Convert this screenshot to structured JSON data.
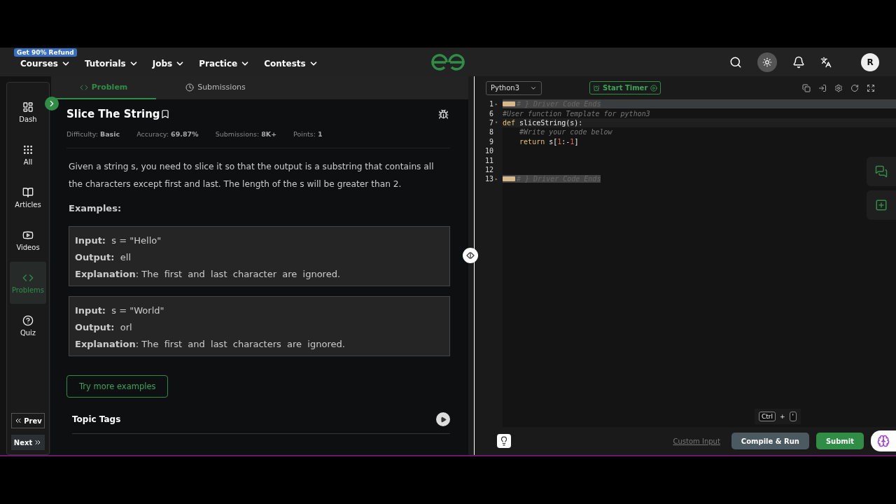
{
  "navbar": {
    "badge": "Get 90% Refund",
    "menus": [
      {
        "label": "Courses"
      },
      {
        "label": "Tutorials"
      },
      {
        "label": "Jobs"
      },
      {
        "label": "Practice"
      },
      {
        "label": "Contests"
      }
    ],
    "avatar": "R"
  },
  "sidebar": {
    "items": [
      {
        "label": "Dash",
        "selected": false
      },
      {
        "label": "All",
        "selected": false
      },
      {
        "label": "Articles",
        "selected": false
      },
      {
        "label": "Videos",
        "selected": false
      },
      {
        "label": "Problems",
        "selected": true
      },
      {
        "label": "Quiz",
        "selected": false
      }
    ],
    "prev": "Prev",
    "next": "Next"
  },
  "tabs": [
    {
      "label": "Problem",
      "selected": true
    },
    {
      "label": "Submissions",
      "selected": false
    }
  ],
  "problem": {
    "title": "Slice The String",
    "meta": [
      {
        "label": "Difficulty:",
        "value": "Basic"
      },
      {
        "label": "Accuracy:",
        "value": "69.87%"
      },
      {
        "label": "Submissions:",
        "value": "8K+"
      },
      {
        "label": "Points:",
        "value": "1"
      }
    ],
    "description": "Given a string s, you need to slice it so that the output is a substring that contains all the characters except first and last. The length of the s will be greater than 2.",
    "examples_heading": "Examples:",
    "examples": [
      [
        {
          "label": "Input:",
          "value": "s = \"Hello\""
        },
        {
          "label": "Output:",
          "value": "ell"
        },
        {
          "label": "Explanation",
          "value": ": The  first  and  last  character  are  ignored."
        }
      ],
      [
        {
          "label": "Input:",
          "value": "s = \"World\""
        },
        {
          "label": "Output:",
          "value": "orl"
        },
        {
          "label": "Explanation",
          "value": ": The  first  and  last  characters  are  ignored."
        }
      ]
    ],
    "more_button": "Try more examples",
    "topic_tags": "Topic Tags"
  },
  "editor": {
    "language": "Python3",
    "timer": "Start Timer",
    "lines": [
      {
        "number": "1",
        "marker": "▸",
        "kind": "band",
        "tokens": [
          {
            "kind": "folded",
            "text": "# } Driver Code Ends"
          }
        ]
      },
      {
        "number": "6",
        "kind": "plain",
        "tokens": [
          {
            "kind": "comment",
            "text": "#User function Template for python3"
          }
        ]
      },
      {
        "number": "7",
        "marker": "▾",
        "kind": "current",
        "tokens": [
          {
            "kind": "keyword",
            "text": "def"
          },
          {
            "kind": "plain",
            "text": " sliceString(s):"
          }
        ]
      },
      {
        "number": "8",
        "kind": "plain",
        "tokens": [
          {
            "kind": "comment",
            "text": "    #Write your code below"
          }
        ]
      },
      {
        "number": "9",
        "kind": "plain",
        "tokens": [
          {
            "kind": "keyword",
            "text": "    return"
          },
          {
            "kind": "plain",
            "text": " s["
          },
          {
            "kind": "number",
            "text": "1"
          },
          {
            "kind": "plain",
            "text": ":-"
          },
          {
            "kind": "number",
            "text": "1"
          },
          {
            "kind": "plain",
            "text": "]"
          }
        ]
      },
      {
        "number": "10",
        "kind": "plain"
      },
      {
        "number": "11",
        "kind": "plain"
      },
      {
        "number": "12",
        "kind": "plain"
      },
      {
        "number": "13",
        "marker": "▸",
        "kind": "plain",
        "tokens": [
          {
            "kind": "folded",
            "text": "# } Driver Code Ends"
          }
        ]
      }
    ],
    "shortcut": {
      "key1": "Ctrl",
      "plus": "+",
      "key2": "'"
    },
    "custom_input": "Custom Input",
    "compile": "Compile & Run",
    "submit": "Submit"
  }
}
